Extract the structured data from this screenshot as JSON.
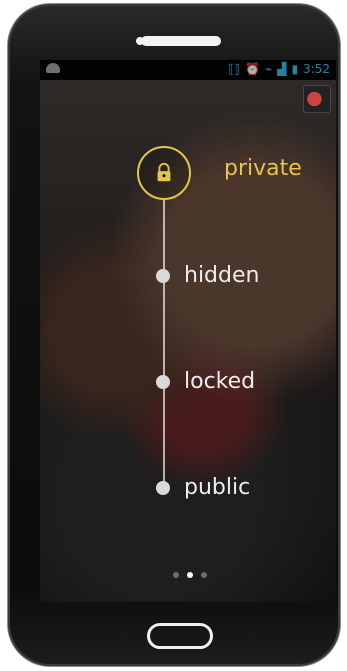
{
  "status_bar": {
    "time": "3:52",
    "icons": [
      "android-icon",
      "vibrate-icon",
      "alarm-icon",
      "wifi-icon",
      "signal-icon",
      "battery-icon"
    ]
  },
  "privacy_picker": {
    "options": [
      {
        "key": "private",
        "label": "private",
        "state": "selected"
      },
      {
        "key": "hidden",
        "label": "hidden",
        "state": "unselected"
      },
      {
        "key": "locked",
        "label": "locked",
        "state": "unselected"
      },
      {
        "key": "public",
        "label": "public",
        "state": "unselected"
      }
    ]
  },
  "pager": {
    "count": 3,
    "active_index": 1
  },
  "colors": {
    "accent_gold": "#e3c64a",
    "status_blue": "#35b5e5"
  }
}
